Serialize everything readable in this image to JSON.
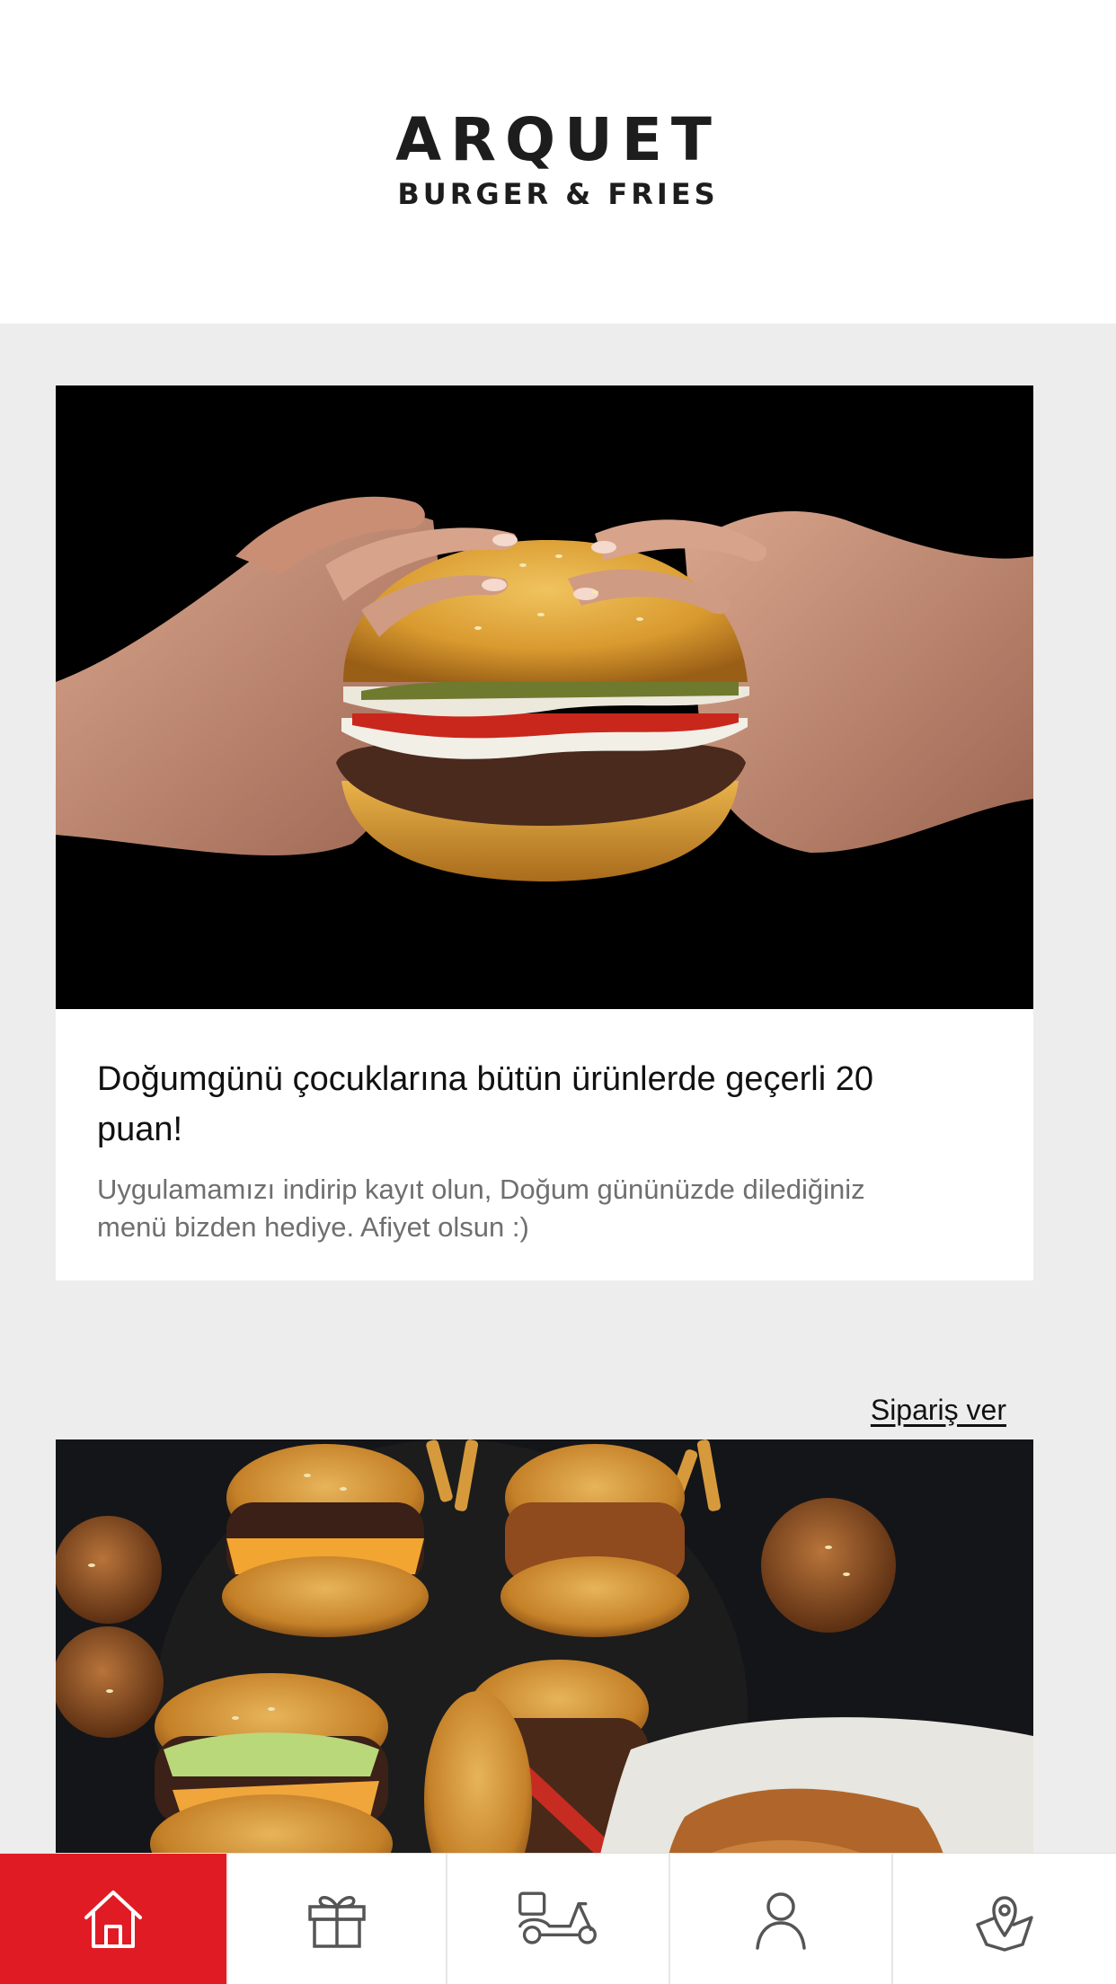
{
  "header": {
    "logo_main": "ARQUET",
    "logo_sub": "BURGER & FRIES"
  },
  "cards": [
    {
      "image": "burger-held-in-hands-photo",
      "title": "Doğumgünü çocuklarına bütün ürünlerde geçerli 20 puan!",
      "text": "Uygulamamızı indirip kayıt olun, Doğum gününüzde dilediğiniz menü bizden hediye. Afiyet olsun :)",
      "link": "Sipariş ver"
    },
    {
      "image": "burgers-and-fried-chicken-photo"
    }
  ],
  "tabbar": {
    "active_color": "#e11b24",
    "items": [
      {
        "icon": "home-icon",
        "active": true
      },
      {
        "icon": "gift-icon",
        "active": false
      },
      {
        "icon": "delivery-scooter-icon",
        "active": false
      },
      {
        "icon": "user-icon",
        "active": false
      },
      {
        "icon": "location-pin-icon",
        "active": false
      }
    ]
  }
}
